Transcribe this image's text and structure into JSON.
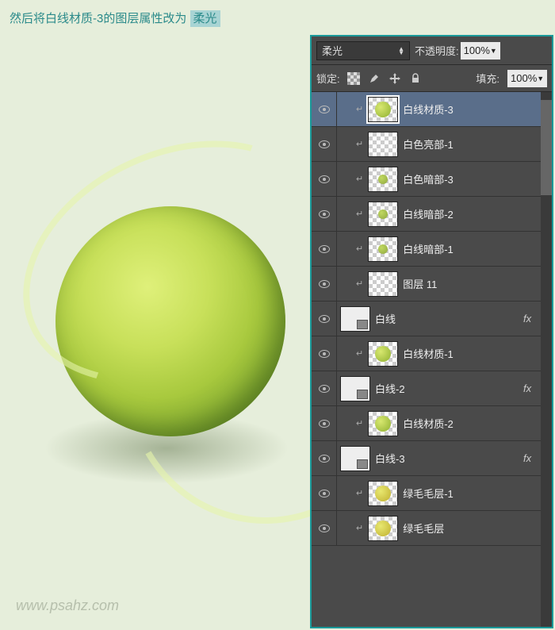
{
  "instruction": {
    "text": "然后将白线材质-3的图层属性改为",
    "highlight": "柔光"
  },
  "watermark": "www.psahz.com",
  "panel": {
    "blend_mode": "柔光",
    "opacity_label": "不透明度:",
    "opacity_value": "100%",
    "lock_label": "锁定:",
    "fill_label": "填充:",
    "fill_value": "100%"
  },
  "layers": [
    {
      "name": "白线材质-3",
      "indent": 1,
      "clip": true,
      "thumb": "ball",
      "selected": true
    },
    {
      "name": "白色亮部-1",
      "indent": 1,
      "clip": true,
      "thumb": "checker"
    },
    {
      "name": "白色暗部-3",
      "indent": 1,
      "clip": true,
      "thumb": "smallball"
    },
    {
      "name": "白线暗部-2",
      "indent": 1,
      "clip": true,
      "thumb": "smallball"
    },
    {
      "name": "白线暗部-1",
      "indent": 1,
      "clip": true,
      "thumb": "smallball"
    },
    {
      "name": "图层 11",
      "indent": 1,
      "clip": true,
      "thumb": "checker"
    },
    {
      "name": "白线",
      "indent": 0,
      "clip": false,
      "thumb": "mask",
      "fx": true
    },
    {
      "name": "白线材质-1",
      "indent": 1,
      "clip": true,
      "thumb": "ball"
    },
    {
      "name": "白线-2",
      "indent": 0,
      "clip": false,
      "thumb": "mask",
      "fx": true
    },
    {
      "name": "白线材质-2",
      "indent": 1,
      "clip": true,
      "thumb": "ball"
    },
    {
      "name": "白线-3",
      "indent": 0,
      "clip": false,
      "thumb": "mask",
      "fx": true
    },
    {
      "name": "绿毛毛层-1",
      "indent": 1,
      "clip": true,
      "thumb": "ballyel"
    },
    {
      "name": "绿毛毛层",
      "indent": 1,
      "clip": true,
      "thumb": "ballyel"
    }
  ],
  "icons": {
    "brush": "brush-icon",
    "move": "move-icon",
    "lock": "lock-icon"
  }
}
